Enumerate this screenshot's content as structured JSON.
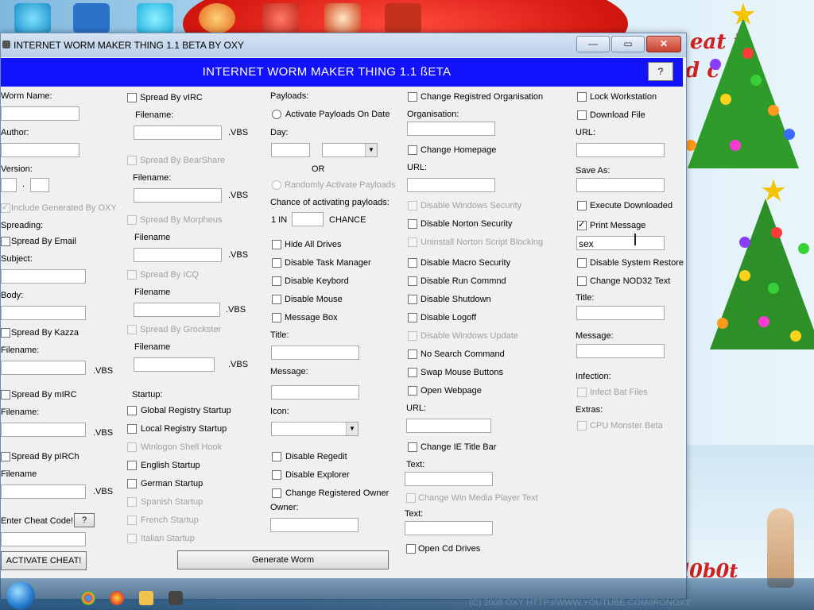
{
  "window": {
    "title": "INTERNET WORM MAKER THING 1.1 BETA BY OXY",
    "banner": "INTERNET WORM MAKER THING 1.1 ßETA",
    "help": "?",
    "minimize": "—",
    "maximize": "▭",
    "close": "✕"
  },
  "col1": {
    "worm_name": "Worm Name:",
    "author": "Author:",
    "version": "Version:",
    "version_dot": ".",
    "include_generated": "Include Generated By OXY",
    "spreading": "Spreading:",
    "spread_email": "Spread By Email",
    "subject": "Subject:",
    "body": "Body:",
    "spread_kazza": "Spread By Kazza",
    "filename": "Filename:",
    "filename_plain": "Filename",
    "vbs": ".VBS",
    "spread_mirc": "Spread By mIRC",
    "spread_pirch": "Spread By pIRCh",
    "cheat_code": "Enter Cheat Code!",
    "cheat_help": "?",
    "activate_cheat": "ACTIVATE CHEAT!"
  },
  "col2": {
    "spread_virc": "Spread By vIRC",
    "filename": "Filename:",
    "filename_plain": "Filename",
    "vbs": ".VBS",
    "spread_bearshare": "Spread By BearShare",
    "spread_morpheus": "Spread By Morpheus",
    "spread_icq": "Spread By ICQ",
    "spread_grockster": "Spread By Grockster",
    "startup": "Startup:",
    "global_registry": "Global Registry Startup",
    "local_registry": "Local Registry Startup",
    "winlogon": "Winlogon Shell Hook",
    "english": "English Startup",
    "german": "German Startup",
    "spanish": "Spanish Startup",
    "french": "French Startup",
    "italian": "Italian Startup",
    "generate": "Generate Worm"
  },
  "col3": {
    "payloads": "Payloads:",
    "activate_on_date": "Activate Payloads On Date",
    "day": "Day:",
    "or": "OR",
    "randomly": "Randomly Activate Payloads",
    "chance_label": "Chance of activating payloads:",
    "one_in": "1 IN",
    "chance": "CHANCE",
    "hide_drives": "Hide All Drives",
    "disable_task_manager": "Disable Task Manager",
    "disable_keybord": "Disable Keybord",
    "disable_mouse": "Disable Mouse",
    "message_box": "Message Box",
    "title": "Title:",
    "message": "Message:",
    "icon": "Icon:",
    "disable_regedit": "Disable Regedit",
    "disable_explorer": "Disable Explorer",
    "change_owner": "Change Registered Owner",
    "owner": "Owner:"
  },
  "col4": {
    "change_org": "Change Registred Organisation",
    "organisation": "Organisation:",
    "change_homepage": "Change Homepage",
    "url": "URL:",
    "disable_win_security": "Disable Windows Security",
    "disable_norton": "Disable Norton Security",
    "uninstall_norton": "Uninstall Norton Script Blocking",
    "disable_macro": "Disable Macro Security",
    "disable_run": "Disable Run Commnd",
    "disable_shutdown": "Disable Shutdown",
    "disable_logoff": "Disable Logoff",
    "disable_win_update": "Disable Windows Update",
    "no_search": "No Search Command",
    "swap_mouse": "Swap Mouse Buttons",
    "open_webpage": "Open Webpage",
    "change_ie_title": "Change IE Title Bar",
    "text": "Text:",
    "change_wmp": "Change Win Media Player Text",
    "open_cd": "Open Cd Drives"
  },
  "col5": {
    "lock_workstation": "Lock Workstation",
    "download_file": "Download File",
    "url": "URL:",
    "save_as": "Save As:",
    "execute_downloaded": "Execute Downloaded",
    "print_message": "Print Message",
    "print_message_value": "sex",
    "disable_system_restore": "Disable System Restore",
    "change_nod32": "Change NOD32 Text",
    "title": "Title:",
    "message": "Message:",
    "infection": "Infection:",
    "infect_bat": "Infect Bat Files",
    "extras": "Extras:",
    "cpu_monster": "CPU Monster Beta"
  },
  "desktop": {
    "copyright": "(C) 2008 OXY HTTP://WWW.YOUTUBE.COM/IRONOXY",
    "side_text_1": "eat it",
    "side_text_2": "d c",
    "side_text_3": "l0b0t"
  },
  "colors": {
    "banner": "#1212ff",
    "disabled_text": "#a0a0a0",
    "close_button": "#c7402e"
  }
}
